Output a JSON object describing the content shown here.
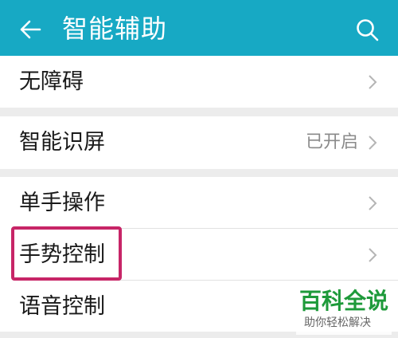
{
  "appbar": {
    "title": "智能辅助",
    "back_icon": "arrow-left-icon",
    "search_icon": "search-icon",
    "color": "#17a9c4"
  },
  "groups": [
    {
      "items": [
        {
          "label": "无障碍",
          "value": ""
        }
      ]
    },
    {
      "items": [
        {
          "label": "智能识屏",
          "value": "已开启"
        }
      ]
    },
    {
      "items": [
        {
          "label": "单手操作",
          "value": ""
        },
        {
          "label": "手势控制",
          "value": ""
        },
        {
          "label": "语音控制",
          "value": ""
        }
      ]
    }
  ],
  "highlight": {
    "color": "#c72567",
    "target": "手势控制"
  },
  "watermark": {
    "brand": "百科全说",
    "sub": "助你轻松解决"
  }
}
